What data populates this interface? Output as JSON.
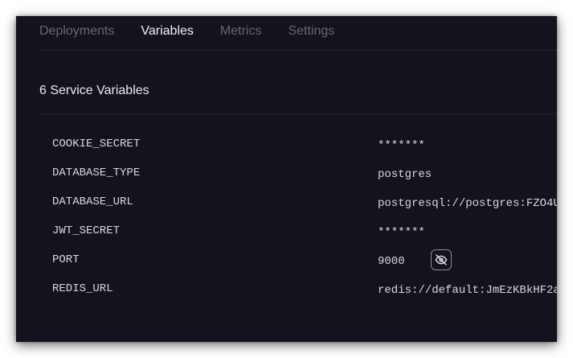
{
  "tabs": [
    {
      "label": "Deployments",
      "active": false
    },
    {
      "label": "Variables",
      "active": true
    },
    {
      "label": "Metrics",
      "active": false
    },
    {
      "label": "Settings",
      "active": false
    }
  ],
  "section": {
    "title": "6 Service Variables"
  },
  "variables": [
    {
      "name": "COOKIE_SECRET",
      "value": "*******"
    },
    {
      "name": "DATABASE_TYPE",
      "value": "postgres"
    },
    {
      "name": "DATABASE_URL",
      "value": "postgresql://postgres:FZO4U"
    },
    {
      "name": "JWT_SECRET",
      "value": "*******"
    },
    {
      "name": "PORT",
      "value": "9000",
      "hover_action": "eye-off-icon"
    },
    {
      "name": "REDIS_URL",
      "value": "redis://default:JmEzKBkHF2a"
    }
  ],
  "colors": {
    "background": "#14121d",
    "text_primary": "#ebe9f2",
    "text_muted": "#696775",
    "active_underline": "#e6e4ee"
  }
}
